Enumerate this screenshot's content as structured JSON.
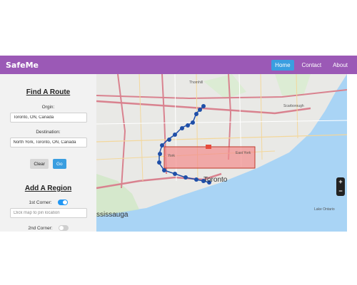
{
  "navbar": {
    "brand": "SafeMe",
    "links": [
      {
        "label": "Home",
        "active": true
      },
      {
        "label": "Contact",
        "active": false
      },
      {
        "label": "About",
        "active": false
      }
    ],
    "color": "#9b59b6",
    "active_color": "#3a9ee0"
  },
  "route": {
    "title": "Find A Route",
    "origin_label": "Orgin:",
    "origin_value": "Toronto, ON, Canada",
    "destination_label": "Destination:",
    "destination_value": "North York, Toronto, ON, Canada",
    "clear_label": "Clear",
    "go_label": "Go"
  },
  "region": {
    "title": "Add A Region",
    "corner1_label": "1st Corner:",
    "corner1_on": true,
    "corner1_placeholder": "Click map to pin location",
    "corner2_label": "2nd Corner:",
    "corner2_on": false
  },
  "map": {
    "labels": {
      "city": "Toronto",
      "west": "ssissauga",
      "lake": "Lake Ontario",
      "york": "York",
      "east_york": "East York",
      "thornhill": "Thornhill",
      "scarborough": "Scarborough"
    },
    "zoom_in": "+",
    "zoom_out": "−",
    "route_color": "#1f4fa8",
    "region_color": "#f28b8b"
  }
}
